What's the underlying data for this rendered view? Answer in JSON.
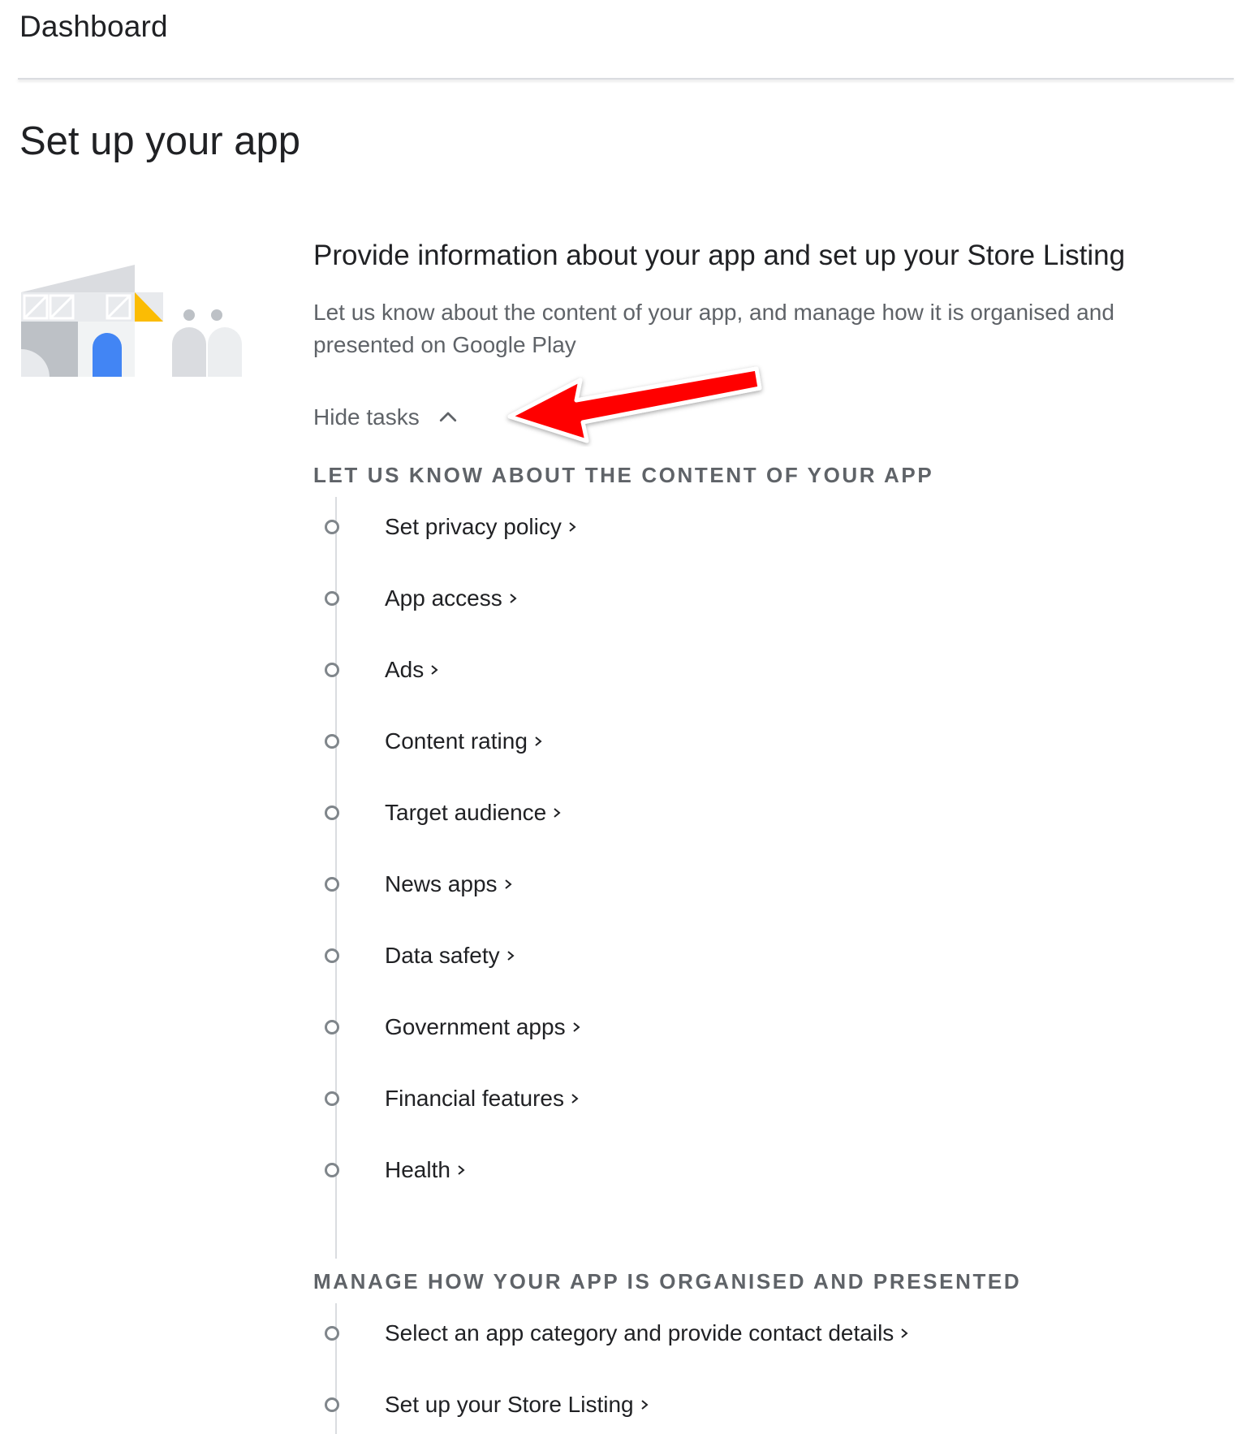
{
  "header": {
    "title": "Dashboard"
  },
  "page": {
    "title": "Set up your app"
  },
  "setup": {
    "heading": "Provide information about your app and set up your Store Listing",
    "description": "Let us know about the content of your app, and manage how it is organised and presented on Google Play",
    "hide_tasks_label": "Hide tasks"
  },
  "groups": [
    {
      "label": "LET US KNOW ABOUT THE CONTENT OF YOUR APP",
      "tasks": [
        "Set privacy policy",
        "App access",
        "Ads",
        "Content rating",
        "Target audience",
        "News apps",
        "Data safety",
        "Government apps",
        "Financial features",
        "Health"
      ]
    },
    {
      "label": "MANAGE HOW YOUR APP IS ORGANISED AND PRESENTED",
      "tasks": [
        "Select an app category and provide contact details",
        "Set up your Store Listing"
      ]
    }
  ],
  "icons": {
    "hide": "chevron-up-icon",
    "task_status": "circle-outline-icon",
    "task_link": "chevron-right-icon"
  },
  "colors": {
    "annotation_arrow": "#ff0000",
    "illustration_blue": "#4285f4",
    "illustration_yellow": "#fbbc04"
  }
}
